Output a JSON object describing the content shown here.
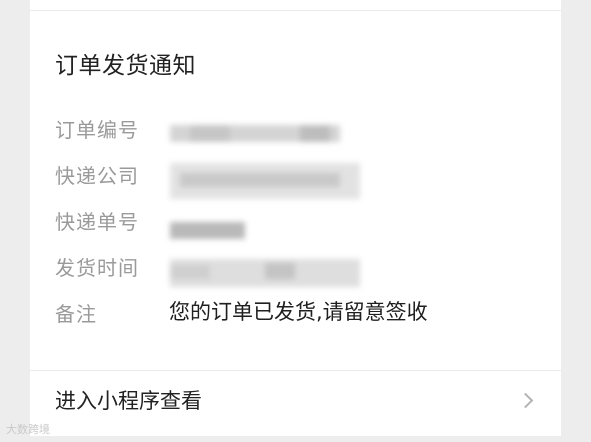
{
  "notification": {
    "title": "订单发货通知",
    "fields": [
      {
        "label": "订单编号",
        "value": "",
        "redacted": true
      },
      {
        "label": "快递公司",
        "value": "",
        "redacted": true
      },
      {
        "label": "快递单号",
        "value": "",
        "redacted": true
      },
      {
        "label": "发货时间",
        "value": "",
        "redacted": true
      },
      {
        "label": "备注",
        "value": "您的订单已发货,请留意签收",
        "redacted": false
      }
    ],
    "link_label": "进入小程序查看",
    "link_icon": "chevron-right-icon"
  },
  "watermark": "大数跨境",
  "colors": {
    "background": "#ededed",
    "card": "#ffffff",
    "label": "#9a9a9a",
    "text": "#222222",
    "redaction": "#d4d4d4"
  }
}
